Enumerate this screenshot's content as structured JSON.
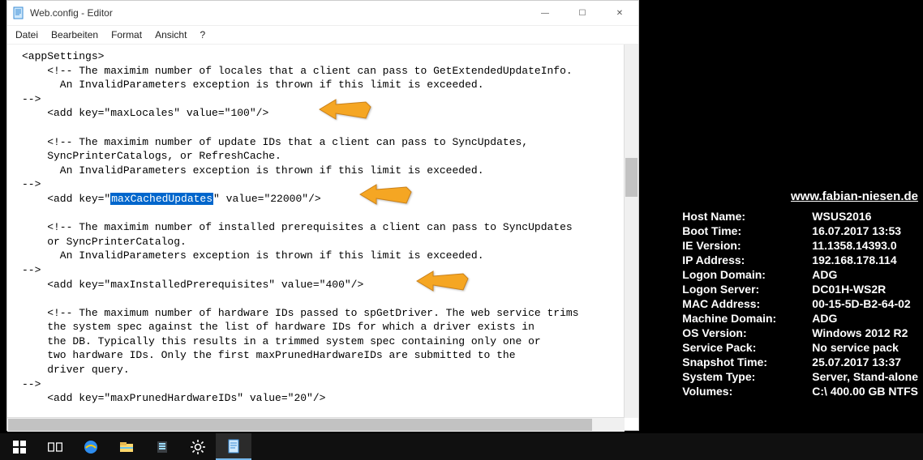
{
  "window": {
    "title": "Web.config - Editor",
    "menus": [
      "Datei",
      "Bearbeiten",
      "Format",
      "Ansicht",
      "?"
    ]
  },
  "code": {
    "l1": "<appSettings>",
    "l2": "    <!-- The maximim number of locales that a client can pass to GetExtendedUpdateInfo.",
    "l3": "      An InvalidParameters exception is thrown if this limit is exceeded.",
    "l4": "-->",
    "l5": "    <add key=\"maxLocales\" value=\"100\"/>",
    "l6": "",
    "l7": "    <!-- The maximim number of update IDs that a client can pass to SyncUpdates,",
    "l8": "    SyncPrinterCatalogs, or RefreshCache.",
    "l9": "      An InvalidParameters exception is thrown if this limit is exceeded.",
    "l10": "-->",
    "l11a": "    <add key=\"",
    "l11h": "maxCachedUpdates",
    "l11b": "\" value=\"22000\"/>",
    "l12": "",
    "l13": "    <!-- The maximim number of installed prerequisites a client can pass to SyncUpdates",
    "l14": "    or SyncPrinterCatalog.",
    "l15": "      An InvalidParameters exception is thrown if this limit is exceeded.",
    "l16": "-->",
    "l17": "    <add key=\"maxInstalledPrerequisites\" value=\"400\"/>",
    "l18": "",
    "l19": "    <!-- The maximum number of hardware IDs passed to spGetDriver. The web service trims",
    "l20": "    the system spec against the list of hardware IDs for which a driver exists in",
    "l21": "    the DB. Typically this results in a trimmed system spec containing only one or",
    "l22": "    two hardware IDs. Only the first maxPrunedHardwareIDs are submitted to the",
    "l23": "    driver query.",
    "l24": "-->",
    "l25": "    <add key=\"maxPrunedHardwareIDs\" value=\"20\"/>"
  },
  "desktop": {
    "url": "www.fabian-niesen.de",
    "rows": [
      {
        "label": "Host Name:",
        "value": "WSUS2016"
      },
      {
        "label": "Boot Time:",
        "value": "16.07.2017 13:53"
      },
      {
        "label": "IE Version:",
        "value": "11.1358.14393.0"
      },
      {
        "label": "IP Address:",
        "value": "192.168.178.114"
      },
      {
        "label": "Logon Domain:",
        "value": "ADG"
      },
      {
        "label": "Logon Server:",
        "value": "DC01H-WS2R"
      },
      {
        "label": "MAC Address:",
        "value": "00-15-5D-B2-64-02"
      },
      {
        "label": "Machine Domain:",
        "value": "ADG"
      },
      {
        "label": "OS Version:",
        "value": "Windows 2012 R2"
      },
      {
        "label": "Service Pack:",
        "value": "No service pack"
      },
      {
        "label": "Snapshot Time:",
        "value": "25.07.2017 13:37"
      },
      {
        "label": "System Type:",
        "value": "Server, Stand-alone"
      },
      {
        "label": "Volumes:",
        "value": "C:\\ 400.00 GB NTFS"
      }
    ]
  }
}
